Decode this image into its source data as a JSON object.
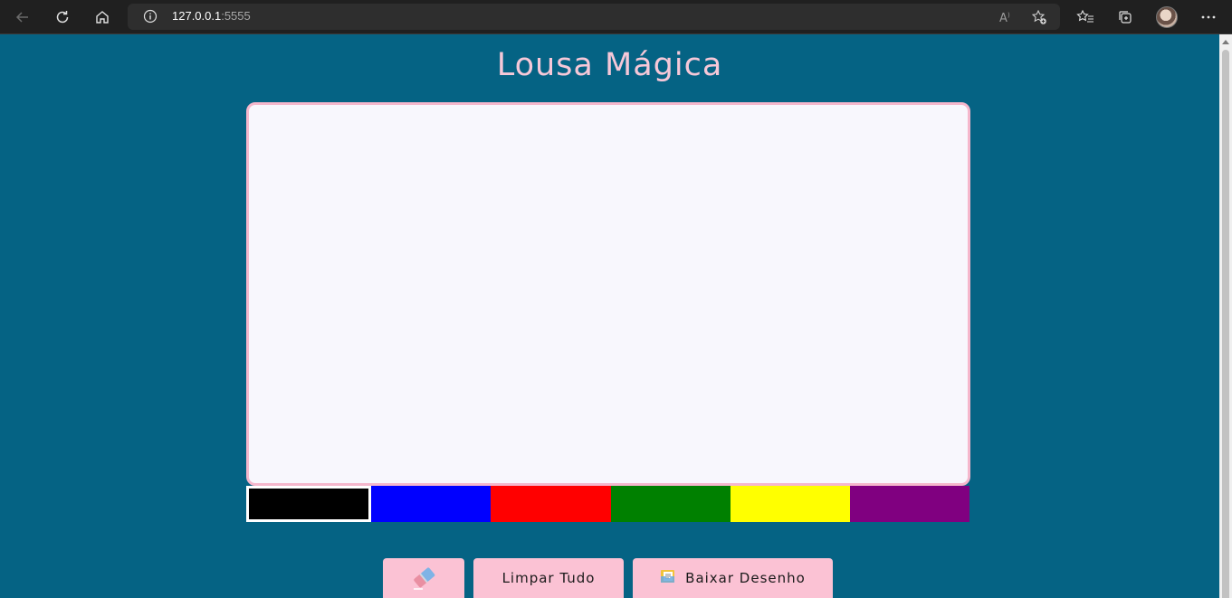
{
  "browser": {
    "url_host": "127.0.0.1",
    "url_port": ":5555"
  },
  "page": {
    "title": "Lousa Mágica",
    "colors": [
      "#000000",
      "#0000ff",
      "#ff0000",
      "#008000",
      "#ffff00",
      "#800080"
    ],
    "selected_color_index": 0,
    "buttons": {
      "eraser_icon": "eraser-icon",
      "clear_label": "Limpar Tudo",
      "download_icon": "folder-icon",
      "download_label": "Baixar Desenho"
    }
  }
}
